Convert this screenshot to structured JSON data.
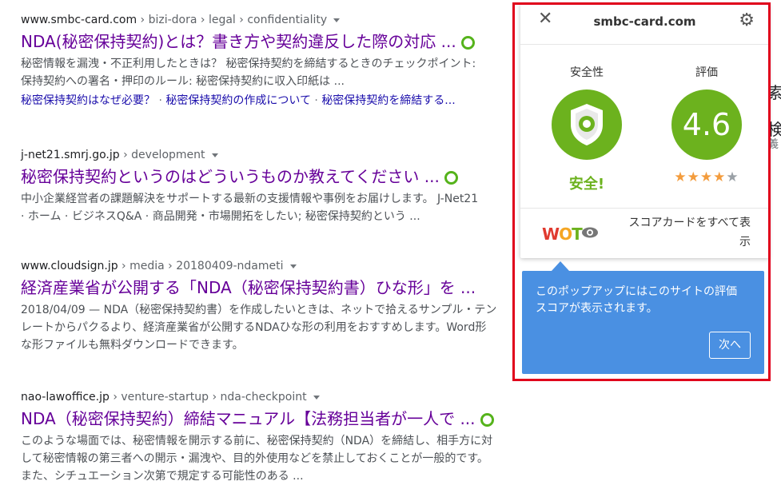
{
  "results": [
    {
      "cite_domain": "www.smbc-card.com",
      "cite_path": " › bizi-dora › legal › confidentiality",
      "title": "NDA(秘密保持契約)とは？書き方や契約違反した際の対応 ...",
      "snippet_line1": "秘密情報を漏洩・不正利用したときは？ 秘密保持契約を締結するときのチェックポイント:",
      "snippet_line2": "保持契約への署名・押印のルール: 秘密保持契約に収入印紙は ...",
      "sitelinks": [
        "秘密保持契約はなぜ必要？",
        "秘密保持契約の作成について",
        "秘密保持契約を締結する..."
      ]
    },
    {
      "cite_domain": "j-net21.smrj.go.jp",
      "cite_path": " › development",
      "title": "秘密保持契約というのはどういうものか教えてください ...",
      "snippet_line1": "中小企業経営者の課題解決をサポートする最新の支援情報や事例をお届けします。 J-Net21",
      "snippet_line2": "· ホーム · ビジネスQ&A · 商品開発・市場開拓をしたい; 秘密保持契約という ..."
    },
    {
      "cite_domain": "www.cloudsign.jp",
      "cite_path": " › media › 20180409-ndameti",
      "title": "経済産業省が公開する「NDA（秘密保持契約書）ひな形」を ...",
      "snippet_line1": "2018/04/09 — NDA（秘密保持契約書）を作成したいときは、ネットで拾えるサンプル・テン",
      "snippet_line2": "レートからパクるより、経済産業省が公開するNDAひな形の利用をおすすめします。Word形",
      "snippet_line3": "な形ファイルも無料ダウンロードできます。"
    },
    {
      "cite_domain": "nao-lawoffice.jp",
      "cite_path": " › venture-startup › nda-checkpoint",
      "title": "NDA（秘密保持契約）締結マニュアル【法務担当者が一人で ...",
      "snippet_line1": "このような場面では、秘密情報を開示する前に、秘密保持契約（NDA）を締結し、相手方に対",
      "snippet_line2": "して秘密情報の第三者への開示・漏洩や、目的外使用などを禁止しておくことが一般的です。",
      "snippet_line3": "また、シチュエーション次第で規定する可能性のある ..."
    }
  ],
  "side_fragments": [
    "索",
    "検",
    "義"
  ],
  "popup": {
    "domain": "smbc-card.com",
    "safety_label": "安全性",
    "safety_status": "安全!",
    "rating_label": "評価",
    "rating_value": "4.6",
    "stars_full": "★★★★",
    "stars_partial": "★",
    "scorecard_line1": "スコアカードをすべて表",
    "scorecard_line2": "示",
    "logo_w": "W",
    "logo_o": "O",
    "logo_t": "T"
  },
  "tooltip": {
    "text_line1": "このポップアップにはこのサイトの評価",
    "text_line2": "スコアが表示されます。",
    "next_label": "次へ"
  },
  "colors": {
    "accent_green": "#6cb21e",
    "highlight_border": "#e0001b",
    "tooltip_blue": "#4a90e2",
    "visited_link": "#660099"
  }
}
